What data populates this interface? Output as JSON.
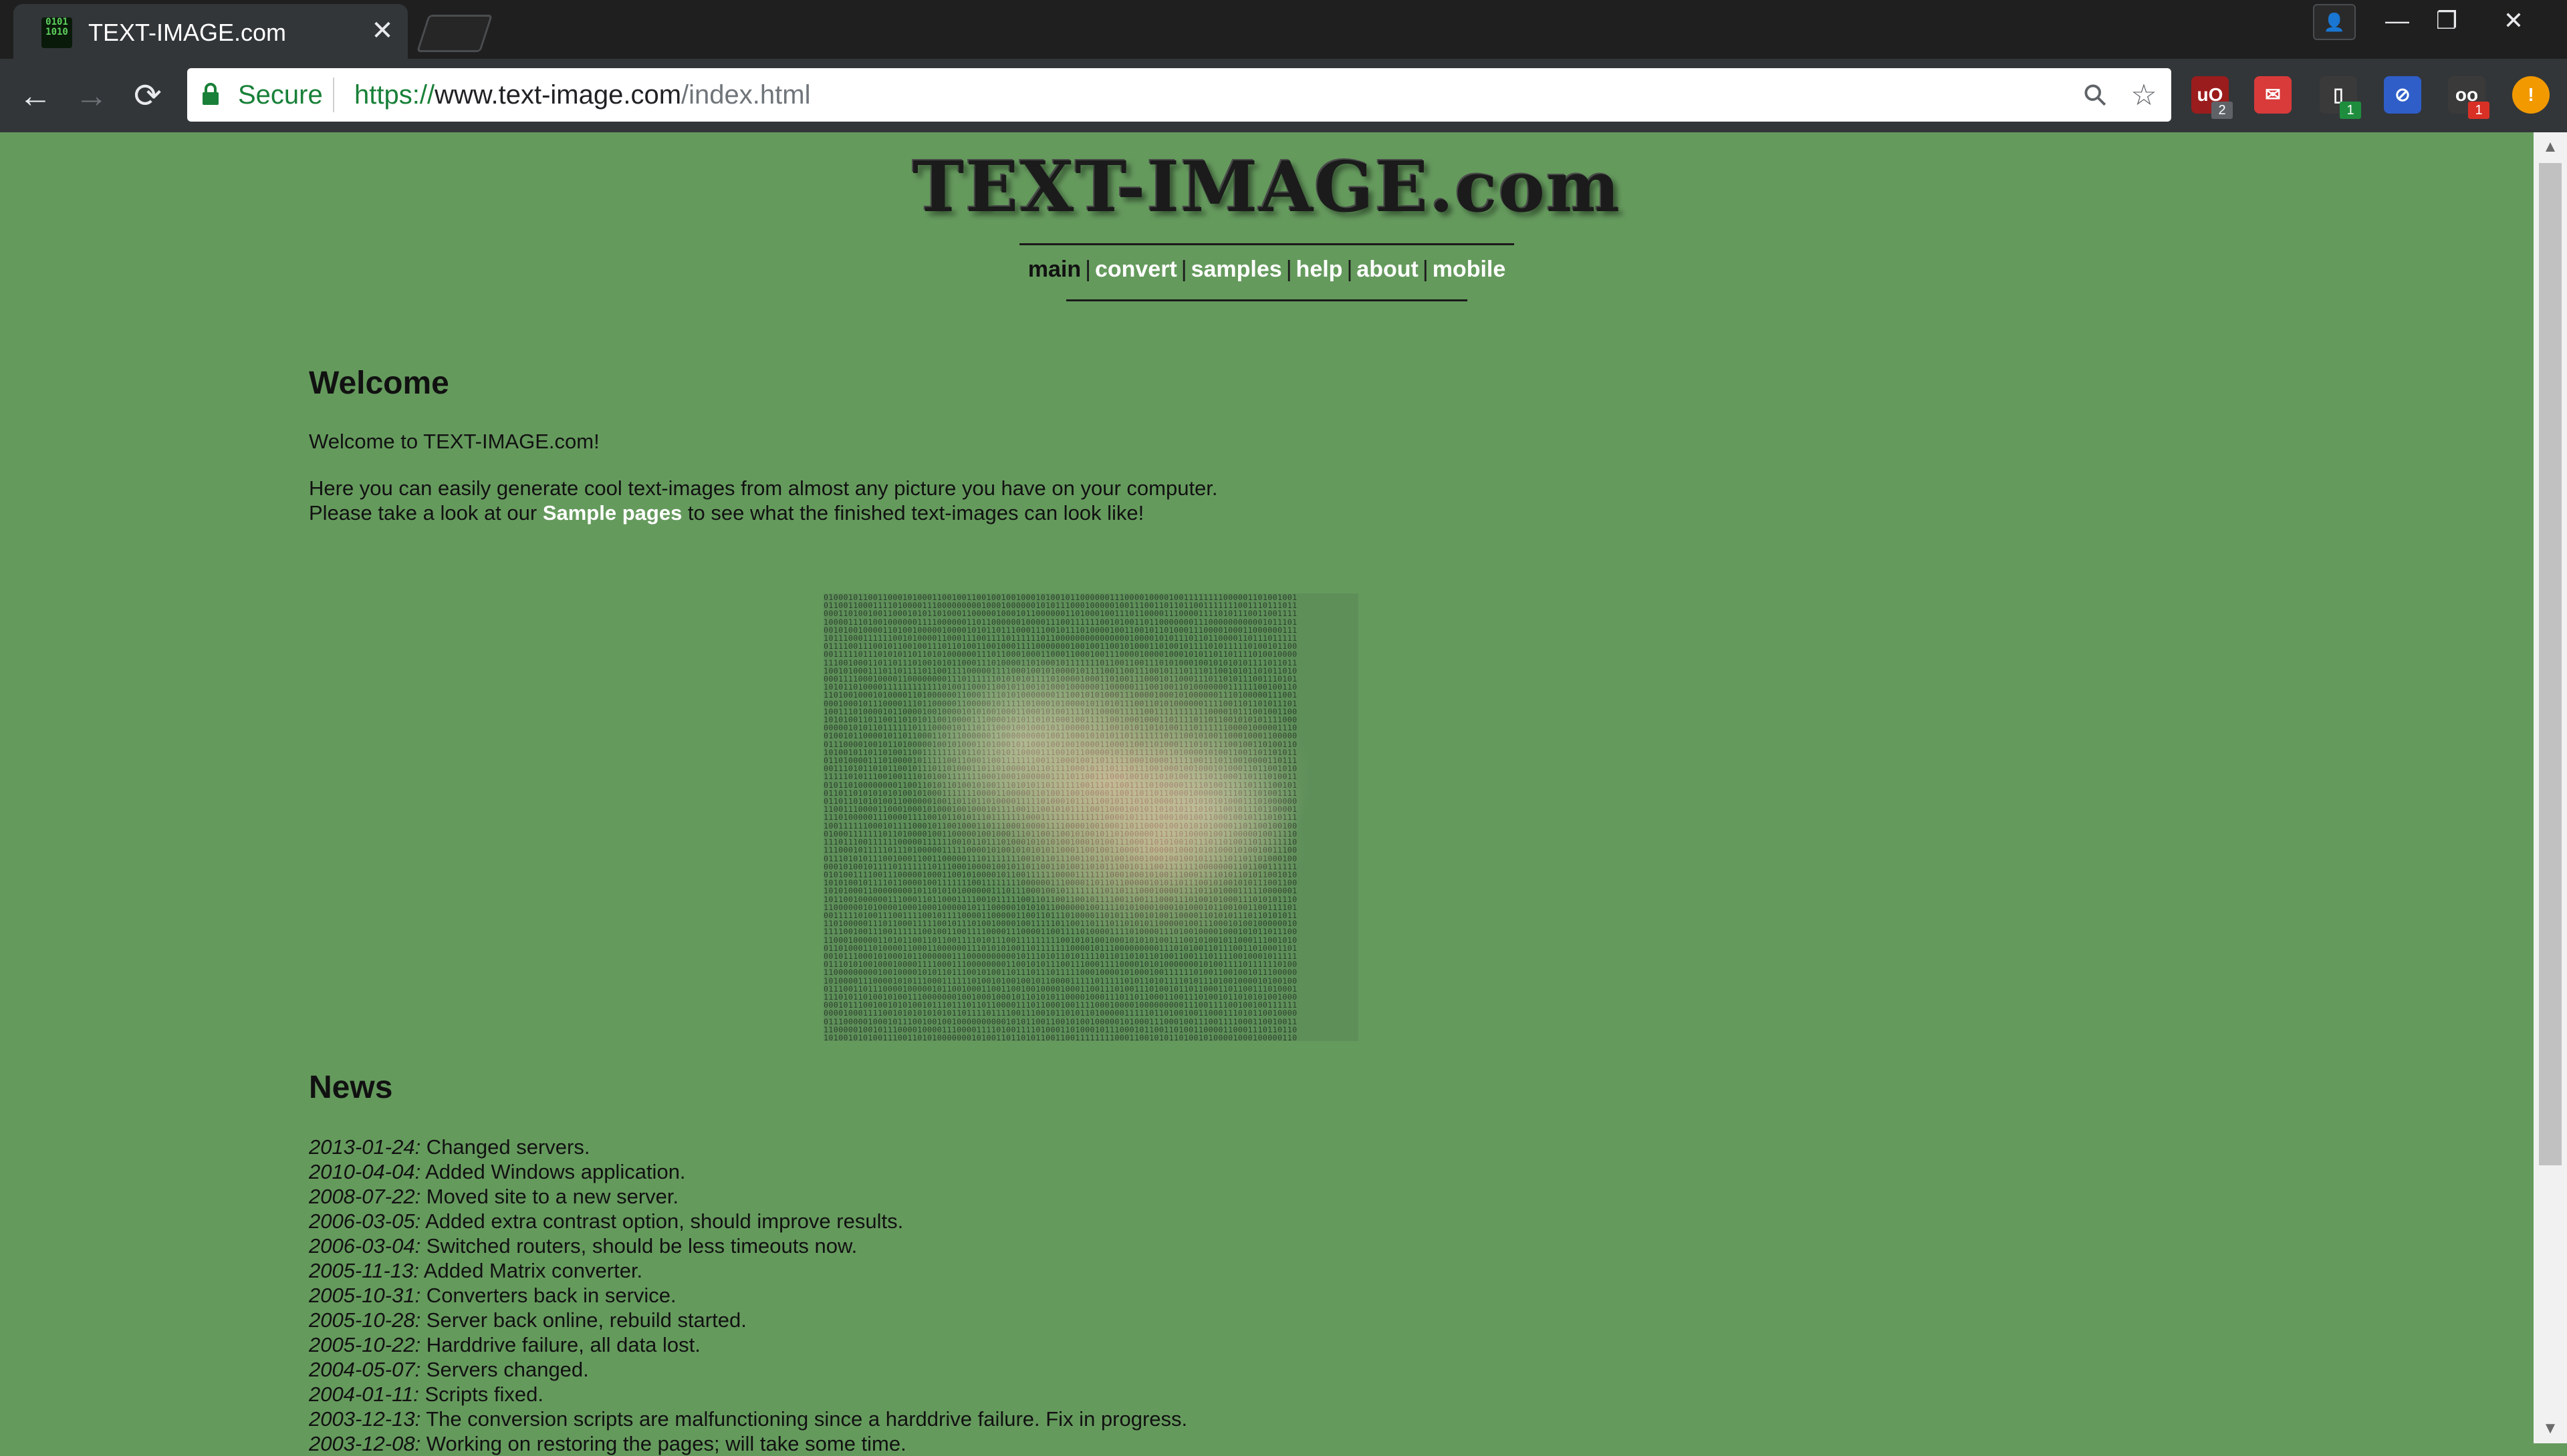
{
  "browser": {
    "tab": {
      "favicon_text": "0101\n1010",
      "title": "TEXT-IMAGE.com",
      "close_glyph": "✕"
    },
    "window_controls": {
      "profile": "👤",
      "minimize": "—",
      "restore": "❐",
      "close": "✕"
    },
    "nav": {
      "back": "←",
      "forward": "→",
      "reload": "⟳"
    },
    "omnibox": {
      "secure_label": "Secure",
      "url_scheme": "https://",
      "url_host": "www.text-image.com",
      "url_path": "/index.html",
      "zoom_icon": "⚲",
      "star_icon": "☆"
    },
    "extensions": [
      {
        "name": "ublock-icon",
        "glyph": "uO",
        "badge": "2",
        "color": "#9b1c1c",
        "badge_color": "#5f6368"
      },
      {
        "name": "pocket-icon",
        "glyph": "✉",
        "badge": "",
        "color": "#d93a3a",
        "badge_color": ""
      },
      {
        "name": "extension-icon",
        "glyph": "▯",
        "badge": "1",
        "color": "#3a3a3a",
        "badge_color": "#1e8e3e"
      },
      {
        "name": "block-icon",
        "glyph": "⊘",
        "badge": "",
        "color": "#2f5ec9",
        "badge_color": ""
      },
      {
        "name": "reader-icon",
        "glyph": "oo",
        "badge": "1",
        "color": "#3a3a3a",
        "badge_color": "#d93025"
      },
      {
        "name": "alert-icon",
        "glyph": "!",
        "badge": "",
        "color": "#f29900",
        "badge_color": ""
      }
    ],
    "scrollbar": {
      "up": "▲",
      "down": "▼"
    }
  },
  "site": {
    "logo": "TEXT-IMAGE.com",
    "nav": [
      {
        "label": "main",
        "active": true
      },
      {
        "label": "convert",
        "active": false
      },
      {
        "label": "samples",
        "active": false
      },
      {
        "label": "help",
        "active": false
      },
      {
        "label": "about",
        "active": false
      },
      {
        "label": "mobile",
        "active": false
      }
    ],
    "nav_separator": "|"
  },
  "welcome": {
    "heading": "Welcome",
    "intro": "Welcome to TEXT-IMAGE.com!",
    "line1": "Here you can easily generate cool text-images from almost any picture you have on your computer.",
    "line2_before": "Please take a look at our ",
    "line2_link": "Sample pages",
    "line2_after": " to see what the finished text-images can look like!"
  },
  "news": {
    "heading": "News",
    "items": [
      {
        "date": "2013-01-24:",
        "text": " Changed servers."
      },
      {
        "date": "2010-04-04:",
        "text": " Added Windows application."
      },
      {
        "date": "2008-07-22:",
        "text": " Moved site to a new server."
      },
      {
        "date": "2006-03-05:",
        "text": " Added extra contrast option, should improve results."
      },
      {
        "date": "2006-03-04:",
        "text": " Switched routers, should be less timeouts now."
      },
      {
        "date": "2005-11-13:",
        "text": " Added Matrix converter."
      },
      {
        "date": "2005-10-31:",
        "text": " Converters back in service."
      },
      {
        "date": "2005-10-28:",
        "text": " Server back online, rebuild started."
      },
      {
        "date": "2005-10-22:",
        "text": " Harddrive failure, all data lost."
      },
      {
        "date": "2004-05-07:",
        "text": " Servers changed."
      },
      {
        "date": "2004-01-11:",
        "text": " Scripts fixed."
      },
      {
        "date": "2003-12-13:",
        "text": " The conversion scripts are malfunctioning since a harddrive failure. Fix in progress."
      },
      {
        "date": "2003-12-08:",
        "text": " Working on restoring the pages; will take some time."
      }
    ]
  }
}
